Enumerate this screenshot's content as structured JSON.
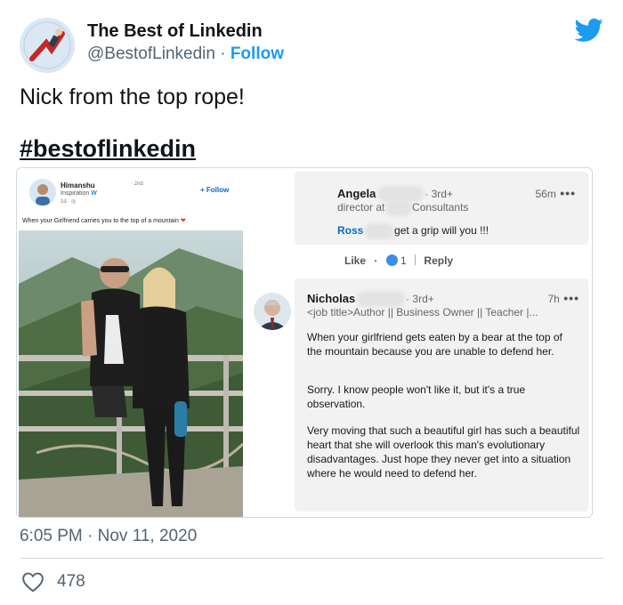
{
  "tweet": {
    "author_name": "The Best of Linkedin",
    "handle": "@BestofLinkedin",
    "separator": "·",
    "follow_label": "Follow",
    "text": "Nick from the top rope!",
    "hashtag": "#bestoflinkedin",
    "timestamp": "6:05 PM · Nov 11, 2020",
    "like_count": "478",
    "icons": [
      "twitter-bird-icon",
      "heart-icon"
    ],
    "colors": {
      "accent": "#1d9bf0",
      "text": "#0f1419",
      "muted": "#536471"
    }
  },
  "linkedin_post": {
    "author": "Himanshu",
    "headline": "Inspiration",
    "time": "1d ·",
    "degree": "· 2nd",
    "follow_label": "+ Follow",
    "text": "When your Girlfriend carries you to the top of a mountain",
    "icons": [
      "verified-icon",
      "globe-icon",
      "heart-icon"
    ]
  },
  "comment1": {
    "name": "Angela",
    "degree": "· 3rd+",
    "title_start": "director at",
    "title_end": "Consultants",
    "time": "56m",
    "more": "•••",
    "mention": "Ross",
    "text": "get a grip will you !!!",
    "like_label": "Like",
    "dot": "·",
    "reaction_count": "1",
    "reply_label": "Reply"
  },
  "comment2": {
    "name": "Nicholas",
    "degree": "· 3rd+",
    "time": "7h",
    "more": "•••",
    "headline": "<job title>Author || Business Owner || Teacher |...",
    "para1": "When your girlfriend gets eaten by a bear at the top of the mountain because you are unable to defend her.",
    "para2": "Sorry. I know people won't like it, but it's a true observation.",
    "para3": "Very moving that such a beautiful girl has such a beautiful heart that she will overlook this man's evolutionary disadvantages. Just hope they never get into a situation where he would need to defend her."
  }
}
